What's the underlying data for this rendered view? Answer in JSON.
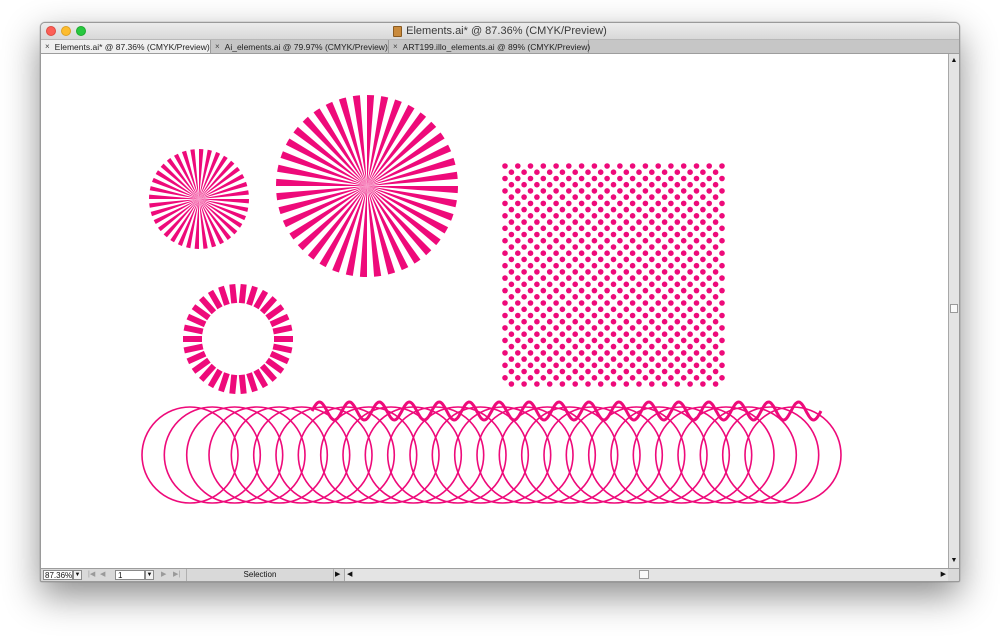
{
  "window": {
    "title": "Elements.ai* @ 87.36% (CMYK/Preview)"
  },
  "tabs": [
    {
      "label": "Elements.ai* @ 87.36% (CMYK/Preview)",
      "active": true
    },
    {
      "label": "Ai_elements.ai @ 79.97% (CMYK/Preview)",
      "active": false
    },
    {
      "label": "ART199.illo_elements.ai @ 89% (CMYK/Preview)",
      "active": false
    }
  ],
  "tab_close_glyph": "×",
  "statusbar": {
    "zoom_value": "87.36%",
    "page_value": "1",
    "tool_status": "Selection"
  },
  "glyphs": {
    "arrow_down": "▼",
    "arrow_up": "▲",
    "arrow_right": "▶",
    "arrow_left": "◀",
    "nav_first": "|◀",
    "nav_prev": "◀",
    "nav_next": "▶",
    "nav_last": "▶|"
  },
  "icons": {
    "document": "document-icon",
    "tab_close": "close-icon"
  },
  "colors": {
    "artwork": "#ee0a7a",
    "close_light": "#fc5f57",
    "minimize_light": "#fdbc2e",
    "zoom_light": "#28c840"
  },
  "artwork": {
    "sunburst_small_rays": 36,
    "sunburst_large_rays": 40,
    "dash_ring_segments": 30,
    "dot_grid_columns": 18,
    "dot_grid_rows": 36,
    "wave_cycles": 17,
    "spring_loops": 28
  }
}
